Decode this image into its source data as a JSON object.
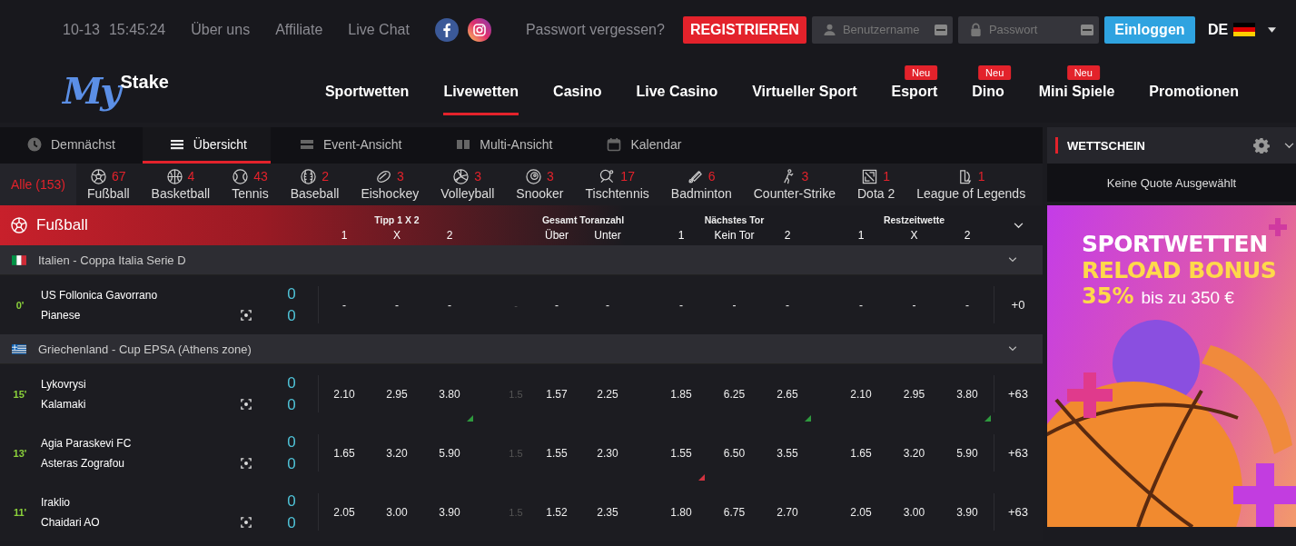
{
  "topbar": {
    "date": "10-13",
    "time": "15:45:24",
    "links": [
      "Über uns",
      "Affiliate",
      "Live Chat"
    ],
    "forgot": "Passwort vergessen?",
    "register": "REGISTRIEREN",
    "username": {
      "placeholder": "Benutzername"
    },
    "password": {
      "placeholder": "Passwort"
    },
    "login": "Einloggen",
    "language": "DE"
  },
  "logo": {
    "part1": "My",
    "part2": "Stake"
  },
  "nav": [
    {
      "label": "Sportwetten",
      "selected": false
    },
    {
      "label": "Livewetten",
      "selected": true
    },
    {
      "label": "Casino",
      "selected": false
    },
    {
      "label": "Live Casino",
      "selected": false
    },
    {
      "label": "Virtueller Sport",
      "selected": false
    },
    {
      "label": "Esport",
      "selected": false,
      "badge": "Neu"
    },
    {
      "label": "Dino",
      "selected": false,
      "badge": "Neu"
    },
    {
      "label": "Mini Spiele",
      "selected": false,
      "badge": "Neu"
    },
    {
      "label": "Promotionen",
      "selected": false
    }
  ],
  "view_tabs": [
    {
      "label": "Demnächst",
      "kind": "clock",
      "selected": false
    },
    {
      "label": "Übersicht",
      "kind": "list",
      "selected": true
    },
    {
      "label": "Event-Ansicht",
      "kind": "rows",
      "selected": false
    },
    {
      "label": "Multi-Ansicht",
      "kind": "columns",
      "selected": false
    },
    {
      "label": "Kalendar",
      "kind": "calendar",
      "selected": false
    }
  ],
  "sport_filters": {
    "all": {
      "label": "Alle (153)",
      "selected": true
    },
    "sports": [
      {
        "label": "Fußball",
        "count": "67",
        "kind": "football",
        "selected": false
      },
      {
        "label": "Basketball",
        "count": "4",
        "kind": "basketball",
        "selected": false
      },
      {
        "label": "Tennis",
        "count": "43",
        "kind": "tennis",
        "selected": false
      },
      {
        "label": "Baseball",
        "count": "2",
        "kind": "baseball",
        "selected": false
      },
      {
        "label": "Eishockey",
        "count": "3",
        "kind": "hockey",
        "selected": false
      },
      {
        "label": "Volleyball",
        "count": "3",
        "kind": "volleyball",
        "selected": false
      },
      {
        "label": "Snooker",
        "count": "3",
        "kind": "snooker",
        "selected": false
      },
      {
        "label": "Tischtennis",
        "count": "17",
        "kind": "tabletennis",
        "selected": false
      },
      {
        "label": "Badminton",
        "count": "6",
        "kind": "badminton",
        "selected": false
      },
      {
        "label": "Counter-Strike",
        "count": "3",
        "kind": "shooter",
        "selected": false
      },
      {
        "label": "Dota 2",
        "count": "1",
        "kind": "dota",
        "selected": false
      },
      {
        "label": "League of Legends",
        "count": "1",
        "kind": "lol",
        "selected": false
      }
    ]
  },
  "sport_header": {
    "name": "Fußball",
    "markets": [
      {
        "title": "Tipp 1 X 2",
        "labels": [
          "1",
          "X",
          "2"
        ]
      },
      {
        "title": "Gesamt Toranzahl",
        "labels": [
          "Über",
          "Unter"
        ]
      },
      {
        "title": "Nächstes Tor",
        "labels": [
          "1",
          "Kein Tor",
          "2"
        ]
      },
      {
        "title": "Restzeitwette",
        "labels": [
          "1",
          "X",
          "2"
        ]
      }
    ]
  },
  "leagues": [
    {
      "name": "Italien - Coppa Italia Serie D",
      "kind": "italy",
      "matches": [
        {
          "time": "0'",
          "home": "US Follonica Gavorrano",
          "away": "Pianese",
          "home_score": "0",
          "away_score": "0",
          "total_line": "-",
          "more": "+0",
          "tipp": [
            {
              "v": "-",
              "up": false,
              "down": false
            },
            {
              "v": "-",
              "up": false,
              "down": false
            },
            {
              "v": "-",
              "up": false,
              "down": false
            }
          ],
          "total": [
            {
              "v": "-",
              "up": false,
              "down": false
            },
            {
              "v": "-",
              "up": false,
              "down": false
            }
          ],
          "next_goal": [
            {
              "v": "-",
              "up": false,
              "down": false
            },
            {
              "v": "-",
              "up": false,
              "down": false
            },
            {
              "v": "-",
              "up": false,
              "down": false
            }
          ],
          "rest": [
            {
              "v": "-",
              "up": false,
              "down": false
            },
            {
              "v": "-",
              "up": false,
              "down": false
            },
            {
              "v": "-",
              "up": false,
              "down": false
            }
          ]
        }
      ]
    },
    {
      "name": "Griechenland - Cup EPSA (Athens zone)",
      "kind": "greece",
      "matches": [
        {
          "time": "15'",
          "home": "Lykovrysi",
          "away": "Kalamaki",
          "home_score": "0",
          "away_score": "0",
          "total_line": "1.5",
          "more": "+63",
          "tipp": [
            {
              "v": "2.10",
              "up": false,
              "down": false
            },
            {
              "v": "2.95",
              "up": false,
              "down": false
            },
            {
              "v": "3.80",
              "up": true,
              "down": false
            }
          ],
          "total": [
            {
              "v": "1.57",
              "up": false,
              "down": false
            },
            {
              "v": "2.25",
              "up": false,
              "down": false
            }
          ],
          "next_goal": [
            {
              "v": "1.85",
              "up": false,
              "down": false
            },
            {
              "v": "6.25",
              "up": false,
              "down": false
            },
            {
              "v": "2.65",
              "up": true,
              "down": false
            }
          ],
          "rest": [
            {
              "v": "2.10",
              "up": false,
              "down": false
            },
            {
              "v": "2.95",
              "up": false,
              "down": false
            },
            {
              "v": "3.80",
              "up": true,
              "down": false
            }
          ]
        },
        {
          "time": "13'",
          "home": "Agia Paraskevi FC",
          "away": "Asteras Zografou",
          "home_score": "0",
          "away_score": "0",
          "total_line": "1.5",
          "more": "+63",
          "tipp": [
            {
              "v": "1.65",
              "up": false,
              "down": false
            },
            {
              "v": "3.20",
              "up": false,
              "down": false
            },
            {
              "v": "5.90",
              "up": false,
              "down": false
            }
          ],
          "total": [
            {
              "v": "1.55",
              "up": false,
              "down": false
            },
            {
              "v": "2.30",
              "up": false,
              "down": false
            }
          ],
          "next_goal": [
            {
              "v": "1.55",
              "up": false,
              "down": true
            },
            {
              "v": "6.50",
              "up": false,
              "down": false
            },
            {
              "v": "3.55",
              "up": false,
              "down": false
            }
          ],
          "rest": [
            {
              "v": "1.65",
              "up": false,
              "down": false
            },
            {
              "v": "3.20",
              "up": false,
              "down": false
            },
            {
              "v": "5.90",
              "up": false,
              "down": false
            }
          ]
        },
        {
          "time": "11'",
          "home": "Iraklio",
          "away": "Chaidari AO",
          "home_score": "0",
          "away_score": "0",
          "total_line": "1.5",
          "more": "+63",
          "tipp": [
            {
              "v": "2.05",
              "up": false,
              "down": false
            },
            {
              "v": "3.00",
              "up": false,
              "down": false
            },
            {
              "v": "3.90",
              "up": false,
              "down": false
            }
          ],
          "total": [
            {
              "v": "1.52",
              "up": false,
              "down": false
            },
            {
              "v": "2.35",
              "up": false,
              "down": false
            }
          ],
          "next_goal": [
            {
              "v": "1.80",
              "up": false,
              "down": false
            },
            {
              "v": "6.75",
              "up": false,
              "down": false
            },
            {
              "v": "2.70",
              "up": false,
              "down": false
            }
          ],
          "rest": [
            {
              "v": "2.05",
              "up": false,
              "down": false
            },
            {
              "v": "3.00",
              "up": false,
              "down": false
            },
            {
              "v": "3.90",
              "up": false,
              "down": false
            }
          ]
        }
      ]
    }
  ],
  "betslip": {
    "title": "WETTSCHEIN",
    "empty": "Keine Quote Ausgewählt"
  },
  "banner": {
    "line1": "SPORTWETTEN",
    "line2": "RELOAD BONUS",
    "percent": "35%",
    "amount": "bis zu 350 €"
  }
}
